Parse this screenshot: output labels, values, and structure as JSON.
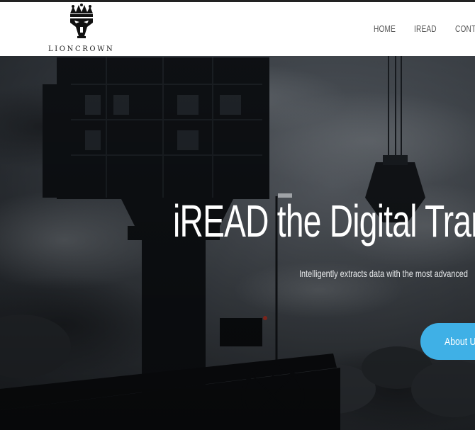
{
  "brand": {
    "name": "LIONCROWN"
  },
  "nav": {
    "items": [
      {
        "label": "HOME"
      },
      {
        "label": "IREAD"
      },
      {
        "label": "CONTACT"
      }
    ]
  },
  "hero": {
    "title": "iREAD the Digital Transformation",
    "subtitle": "Intelligently extracts data with the most advanced",
    "cta_label": "About Us"
  },
  "colors": {
    "accent": "#3fb0e6",
    "nav_text": "#555555",
    "hero_text": "#ffffff"
  }
}
